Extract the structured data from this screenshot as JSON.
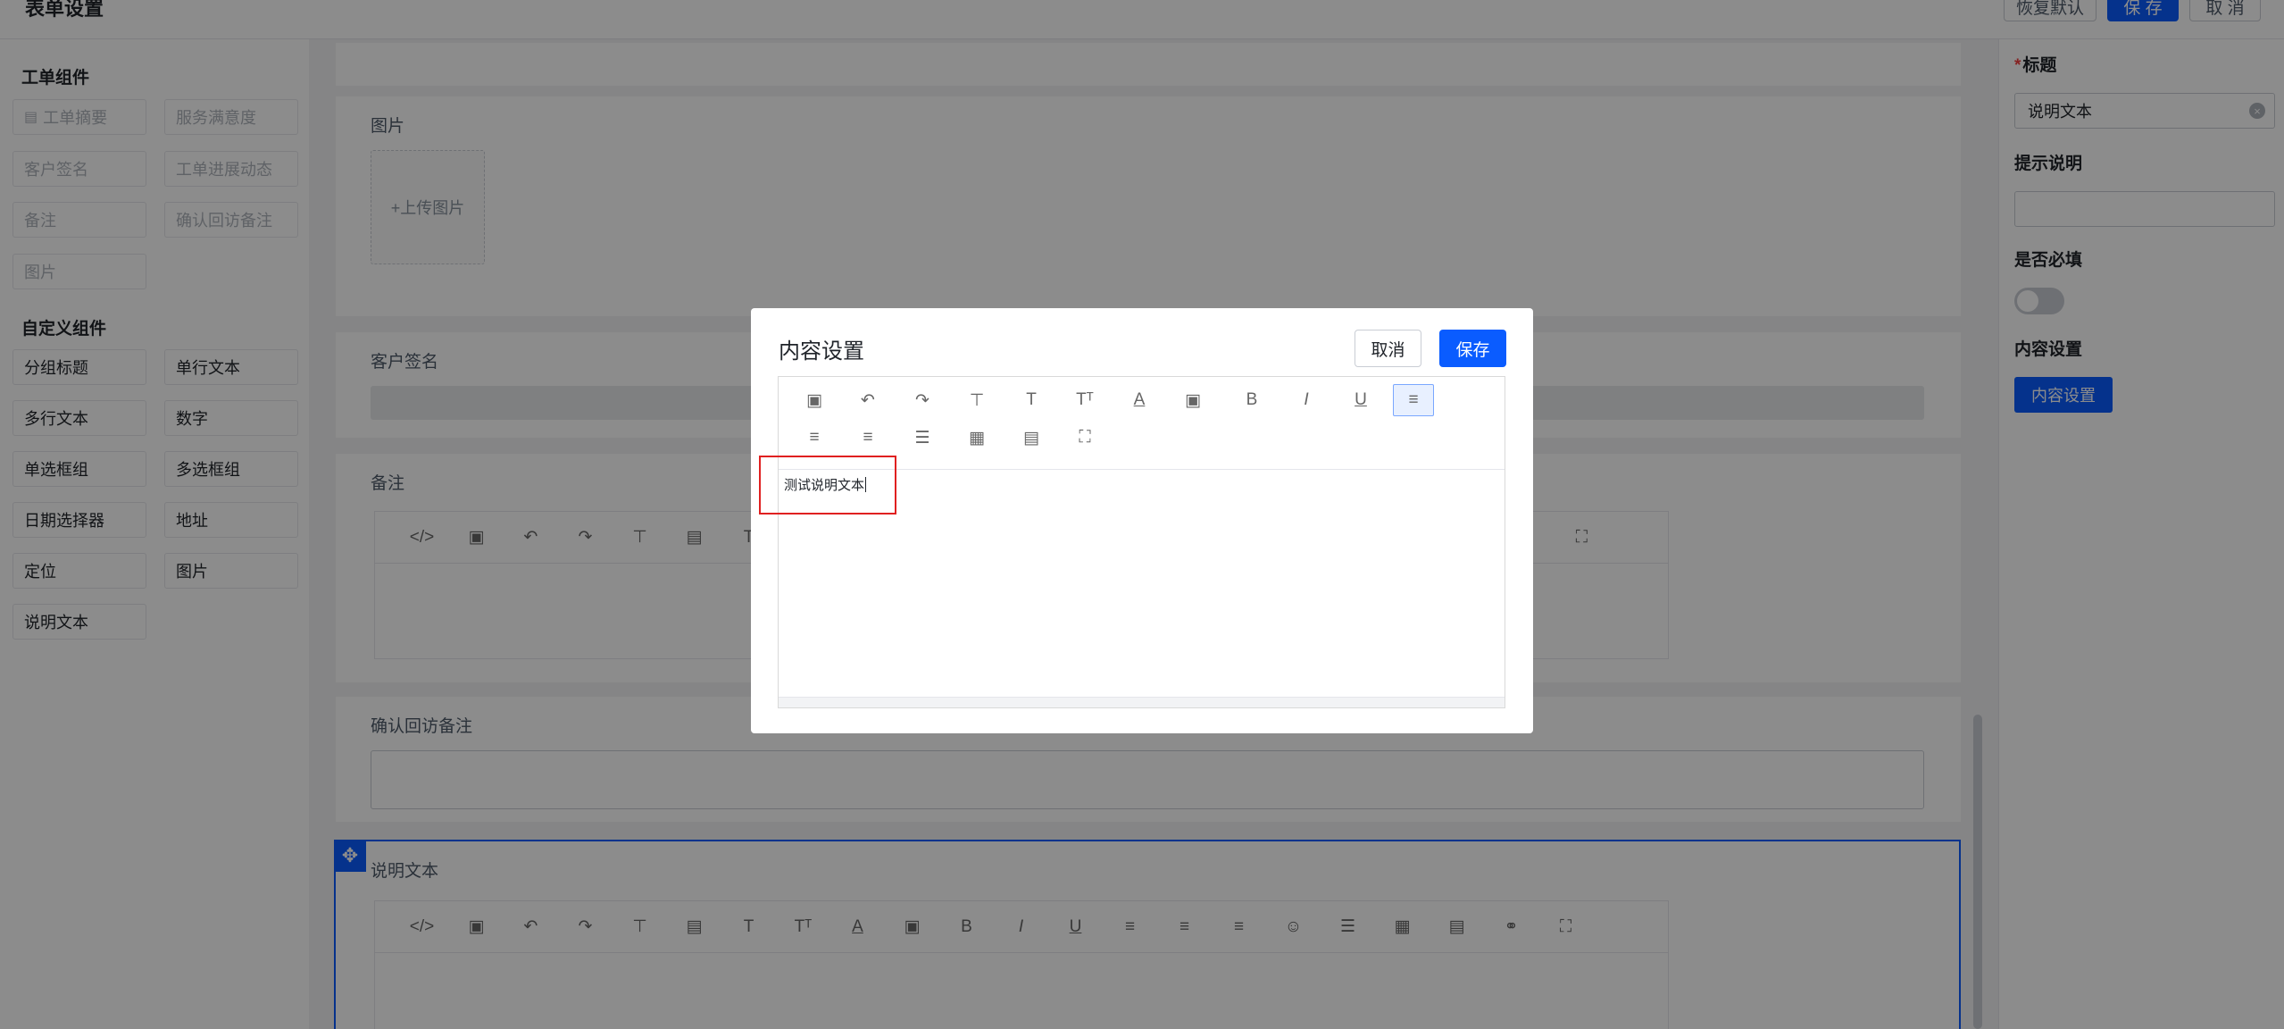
{
  "header": {
    "title": "表单设置",
    "restore_label": "恢复默认",
    "save_label": "保 存",
    "cancel_label": "取 消"
  },
  "palette": {
    "ticket_group_title": "工单组件",
    "ticket_components": [
      {
        "label": "工单摘要",
        "icon": "list-icon"
      },
      {
        "label": "服务满意度"
      },
      {
        "label": "客户签名"
      },
      {
        "label": "工单进展动态"
      },
      {
        "label": "备注"
      },
      {
        "label": "确认回访备注"
      },
      {
        "label": "图片"
      }
    ],
    "custom_group_title": "自定义组件",
    "custom_components": [
      "分组标题",
      "单行文本",
      "多行文本",
      "数字",
      "单选框组",
      "多选框组",
      "日期选择器",
      "地址",
      "定位",
      "图片",
      "说明文本"
    ]
  },
  "canvas": {
    "image_label": "图片",
    "upload_label": "+上传图片",
    "signature_label": "客户签名",
    "remark_label": "备注",
    "followup_label": "确认回访备注",
    "desc_label": "说明文本"
  },
  "properties": {
    "title_label": "标题",
    "title_value": "说明文本",
    "hint_label": "提示说明",
    "hint_value": "",
    "required_label": "是否必填",
    "required_on": false,
    "content_label": "内容设置",
    "content_button": "内容设置"
  },
  "modal": {
    "title": "内容设置",
    "cancel_label": "取消",
    "save_label": "保存",
    "content_text": "测试说明文本"
  },
  "colors": {
    "accent": "#0a5cff",
    "required_star": "#f53f3f",
    "highlight_box": "#e02020"
  }
}
